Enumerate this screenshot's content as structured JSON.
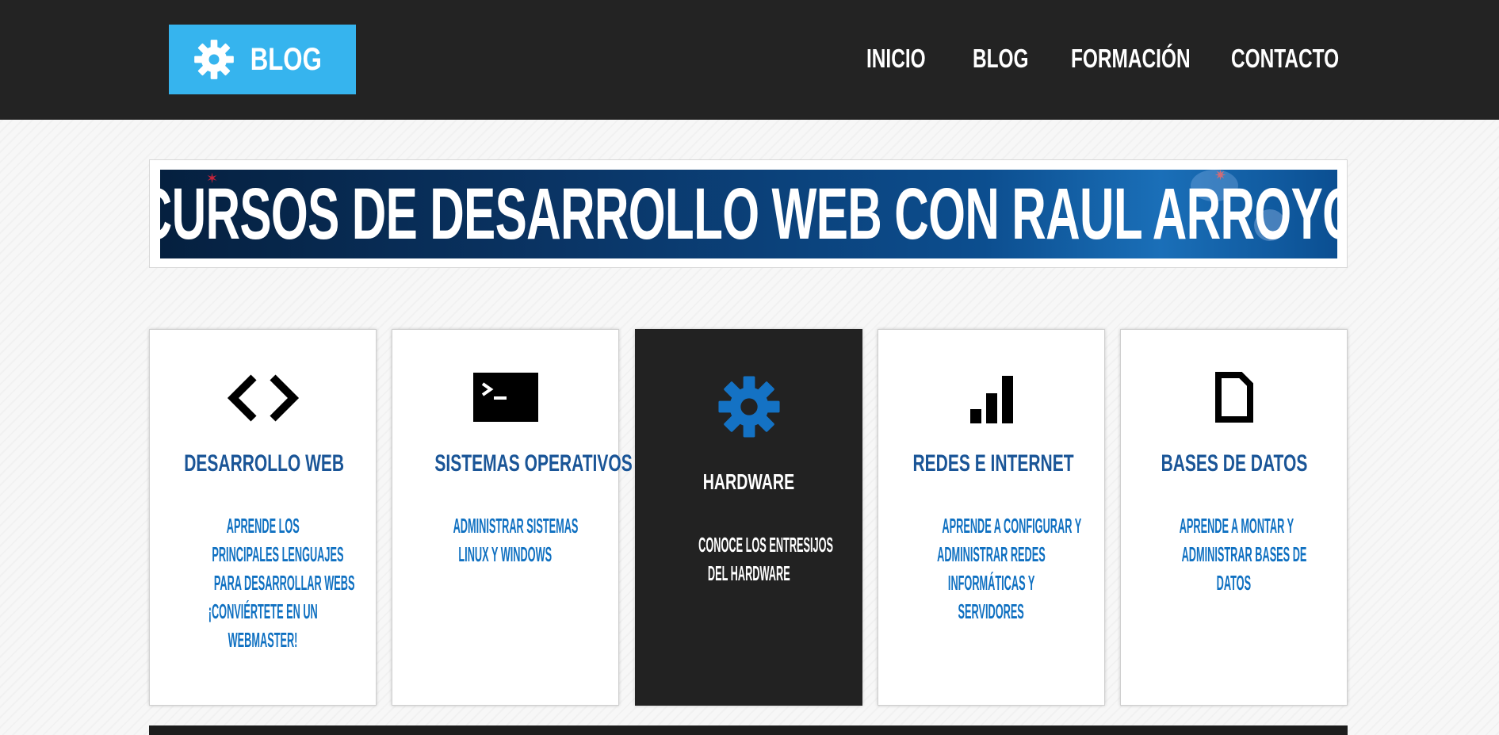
{
  "header": {
    "logo_text": "BLOG",
    "logo_icon": "gear-icon",
    "nav": [
      {
        "label": "INICIO"
      },
      {
        "label": "BLOG"
      },
      {
        "label": "FORMACIÓN"
      },
      {
        "label": "CONTACTO"
      }
    ]
  },
  "banner": {
    "title": "CURSOS DE DESARROLLO WEB CON RAUL ARROYO"
  },
  "cards": [
    {
      "icon": "code-icon",
      "title": "DESARROLLO WEB",
      "desc_lines": [
        "APRENDE LOS",
        "PRINCIPALES LENGUAJES",
        "PARA DESARROLLAR WEBS",
        "¡CONVIÉRTETE EN UN",
        "WEBMASTER!"
      ]
    },
    {
      "icon": "terminal-icon",
      "title": "SISTEMAS OPERATIVOS",
      "desc_lines": [
        "ADMINISTRAR SISTEMAS",
        "LINUX Y WINDOWS"
      ]
    },
    {
      "icon": "gear-icon",
      "title": "HARDWARE",
      "desc_lines": [
        "CONOCE LOS ENTRESIJOS",
        "DEL HARDWARE"
      ]
    },
    {
      "icon": "signal-bars-icon",
      "title": "REDES E INTERNET",
      "desc_lines": [
        "APRENDE A CONFIGURAR Y",
        "ADMINISTRAR REDES",
        "INFORMÁTICAS Y",
        "SERVIDORES"
      ]
    },
    {
      "icon": "document-icon",
      "title": "BASES DE DATOS",
      "desc_lines": [
        "APRENDE A MONTAR Y",
        "ADMINISTRAR BASES DE",
        "DATOS"
      ]
    }
  ],
  "colors": {
    "header_bg": "#232323",
    "logo_bg": "#36b4ee",
    "title_blue": "#1a5597",
    "desc_blue": "#0f70c1",
    "gear_blue": "#1472c4",
    "dark_card": "#222222"
  }
}
